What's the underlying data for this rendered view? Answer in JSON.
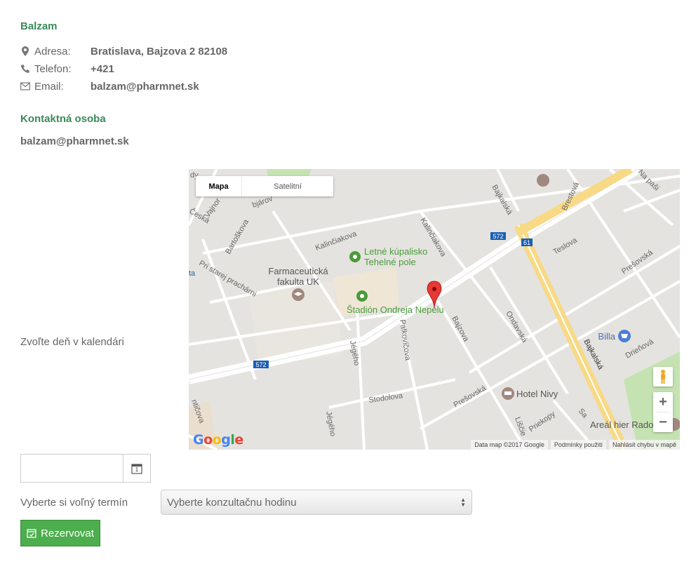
{
  "company": {
    "name": "Balzam",
    "address_label": "Adresa:",
    "address_value": "Bratislava, Bajzova 2 82108",
    "phone_label": "Telefon:",
    "phone_value": "+421",
    "email_label": "Email:",
    "email_value": "balzam@pharmnet.sk"
  },
  "contact": {
    "title": "Kontaktná osoba",
    "email": "balzam@pharmnet.sk"
  },
  "calendar": {
    "label": "Zvoľte deň v kalendári",
    "date_value": "",
    "calendar_day": "1"
  },
  "map": {
    "type_map": "Mapa",
    "type_satellite": "Satelitní",
    "attribution": "Data map ©2017 Google",
    "terms": "Podmínky použití",
    "report": "Nahlásit chybu v mapě",
    "places": {
      "pool_line1": "Letné kúpalisko",
      "pool_line2": "Tehelné pole",
      "faculty_line1": "Farmaceutická",
      "faculty_line2": "fakulta UK",
      "stadium": "Štadión Ondreja Nepelu",
      "billa": "Billa",
      "hotel": "Hotel Nivy",
      "areal": "Areál hier Rado"
    },
    "streets": {
      "kalinciakova1": "Kalinčiakova",
      "kalinciakova2": "Kalinčiakova",
      "bajkalska1": "Bajkalská",
      "bajkalska2": "Bajkalská",
      "brestova": "Brestová",
      "teslova": "Teslova",
      "presovska1": "Prešovská",
      "presovska2": "Prešovská",
      "bajzova": "Bajzova",
      "ondavska": "Ondavská",
      "palkovicova": "Palkovičova",
      "jegeho1": "Jégého",
      "jegeho2": "Jégého",
      "stodolova": "Stodolova",
      "bartoskova": "Bartoškova",
      "pri_starej": "Pri starej prachárni",
      "vajnorska": "Vajnor",
      "ceska": "Česká",
      "obajarov": "bjárov",
      "dneprova": "Drieňová",
      "na_pasi": "Na paši",
      "liscie": "Liščie",
      "priekopy": "Priekopy",
      "sa": "Sa",
      "nticova": "ntičova",
      "ta": "ta",
      "dy": "dy"
    },
    "road_badges": {
      "r572a": "572",
      "r572b": "572",
      "r61": "61"
    },
    "logo_letters": [
      "G",
      "o",
      "o",
      "g",
      "l",
      "e"
    ],
    "colors": {
      "background": "#e5e3df",
      "road": "#ffffff",
      "major_road": "#f8d985",
      "park": "#c5e3b2",
      "poi_green": "#4a9b3b",
      "pin": "#e53935"
    }
  },
  "booking": {
    "label": "Vyberte si voľný termín",
    "select_value": "Vyberte konzultačnu hodinu",
    "reserve_label": "Rezervovat"
  },
  "colors": {
    "accent_green": "#3a8a5a",
    "button_green": "#4cae4c"
  }
}
